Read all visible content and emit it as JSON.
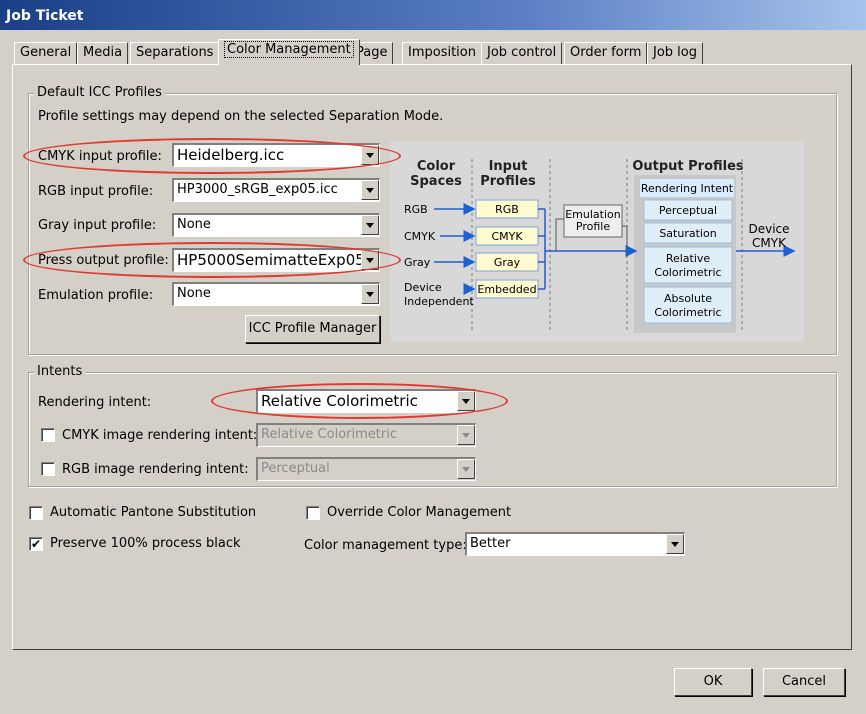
{
  "window": {
    "title": "Job Ticket"
  },
  "tabs": [
    {
      "label": "General"
    },
    {
      "label": "Media"
    },
    {
      "label": "Separations"
    },
    {
      "label": "Color Management",
      "active": true
    },
    {
      "label": "Page"
    },
    {
      "label": "Imposition"
    },
    {
      "label": "Job control"
    },
    {
      "label": "Order form"
    },
    {
      "label": "Job log"
    }
  ],
  "icc_group": {
    "title": "Default ICC Profiles",
    "note": "Profile settings may depend on the selected Separation Mode.",
    "cmyk_input": {
      "label": "CMYK input profile:",
      "value": "Heidelberg.icc"
    },
    "rgb_input": {
      "label": "RGB input profile:",
      "value": "HP3000_sRGB_exp05.icc"
    },
    "gray_input": {
      "label": "Gray input profile:",
      "value": "None"
    },
    "press_output": {
      "label": "Press output profile:",
      "value": "HP5000SemimatteExp05"
    },
    "emulation": {
      "label": "Emulation profile:",
      "value": "None"
    },
    "manager_button": "ICC Profile Manager"
  },
  "diagram": {
    "col_color_spaces": [
      "Color",
      "Spaces"
    ],
    "col_input_profiles": [
      "Input",
      "Profiles"
    ],
    "col_output_profiles": "Output Profiles",
    "spaces": [
      "RGB",
      "CMYK",
      "Gray",
      "Device",
      "Independent"
    ],
    "inputs": [
      "RGB",
      "CMYK",
      "Gray",
      "Embedded"
    ],
    "emulation": [
      "Emulation",
      "Profile"
    ],
    "rendering_intent": "Rendering Intent",
    "intents": [
      "Perceptual",
      "Saturation",
      "Relative",
      "Colorimetric",
      "Absolute",
      "Colorimetric"
    ],
    "device": [
      "Device",
      "CMYK"
    ]
  },
  "intents_group": {
    "title": "Intents",
    "rendering_label": "Rendering intent:",
    "rendering_value": "Relative Colorimetric",
    "cmyk_image": {
      "label": "CMYK image rendering intent:",
      "value": "Relative Colorimetric",
      "checked": false
    },
    "rgb_image": {
      "label": "RGB image rendering intent:",
      "value": "Perceptual",
      "checked": false
    }
  },
  "options": {
    "auto_pantone": {
      "label": "Automatic Pantone Substitution",
      "checked": false
    },
    "preserve_black": {
      "label": "Preserve 100% process black",
      "checked": true
    },
    "override_cm": {
      "label": "Override Color Management",
      "checked": false
    },
    "cm_type": {
      "label": "Color management type:",
      "value": "Better"
    }
  },
  "footer": {
    "ok": "OK",
    "cancel": "Cancel"
  },
  "colors": {
    "highlight": "#e03a30",
    "diagram_arrow": "#1f5fd0",
    "diagram_box": "#fffbd0"
  }
}
